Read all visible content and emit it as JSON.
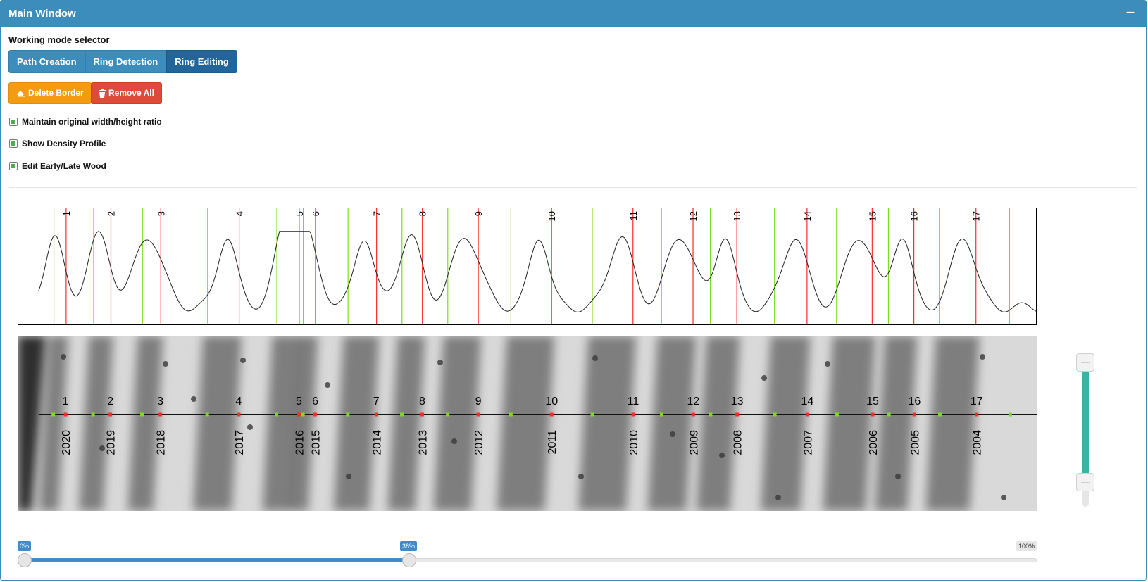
{
  "window": {
    "title": "Main Window",
    "collapse_symbol": "−"
  },
  "working_mode": {
    "label": "Working mode selector",
    "modes": [
      "Path Creation",
      "Ring Detection",
      "Ring Editing"
    ],
    "active": "Ring Editing"
  },
  "actions": {
    "delete_border": "Delete Border",
    "remove_all": "Remove All"
  },
  "options": [
    {
      "label": "Maintain original width/height ratio",
      "checked": true
    },
    {
      "label": "Show Density Profile",
      "checked": true
    },
    {
      "label": "Edit Early/Late Wood",
      "checked": true
    }
  ],
  "rings": [
    {
      "n": "1",
      "year": "2020",
      "x": 0.047
    },
    {
      "n": "2",
      "year": "2019",
      "x": 0.091
    },
    {
      "n": "3",
      "year": "2018",
      "x": 0.14
    },
    {
      "n": "4",
      "year": "2017",
      "x": 0.217
    },
    {
      "n": "5",
      "year": "2016",
      "x": 0.276
    },
    {
      "n": "6",
      "year": "2015",
      "x": 0.292
    },
    {
      "n": "7",
      "year": "2014",
      "x": 0.352
    },
    {
      "n": "8",
      "year": "2013",
      "x": 0.397
    },
    {
      "n": "9",
      "year": "2012",
      "x": 0.452
    },
    {
      "n": "10",
      "year": "2011",
      "x": 0.524
    },
    {
      "n": "11",
      "year": "2010",
      "x": 0.604
    },
    {
      "n": "12",
      "year": "2009",
      "x": 0.663
    },
    {
      "n": "13",
      "year": "2008",
      "x": 0.706
    },
    {
      "n": "14",
      "year": "2007",
      "x": 0.775
    },
    {
      "n": "15",
      "year": "2006",
      "x": 0.839
    },
    {
      "n": "16",
      "year": "2005",
      "x": 0.88
    },
    {
      "n": "17",
      "year": "2004",
      "x": 0.941
    }
  ],
  "early_late_borders": [
    0.035,
    0.074,
    0.122,
    0.186,
    0.254,
    0.28,
    0.324,
    0.377,
    0.422,
    0.484,
    0.564,
    0.632,
    0.68,
    0.743,
    0.804,
    0.855,
    0.905,
    0.974
  ],
  "zoom_slider": {
    "min_label": "0%",
    "value_label": "38%",
    "max_label": "100%",
    "value": 0.38
  },
  "vertical_slider": {
    "low": 0.16,
    "high": 0.94
  },
  "colors": {
    "ring_border": "#ff2a2a",
    "early_late_border": "#7ddc1f",
    "path": "#111111",
    "accent": "#3c8dbc"
  }
}
